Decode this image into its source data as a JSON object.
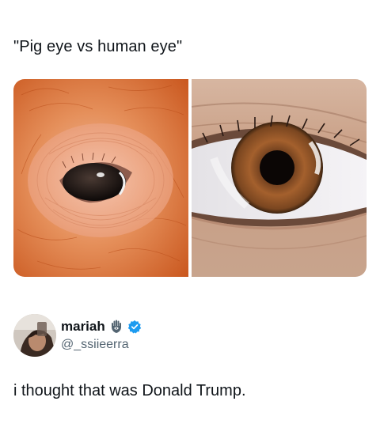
{
  "post": {
    "title": "\"Pig eye vs human eye\"",
    "images": [
      {
        "icon": "pig-eye-photo"
      },
      {
        "icon": "human-eye-photo"
      }
    ]
  },
  "quoted_user": {
    "display_name": "mariah",
    "handle": "@_ssiieerra",
    "badges": [
      "hamsa-icon",
      "verified-badge-icon"
    ],
    "verified_color": "#1d9bf0"
  },
  "reply": {
    "text": "i thought that was Donald Trump."
  }
}
